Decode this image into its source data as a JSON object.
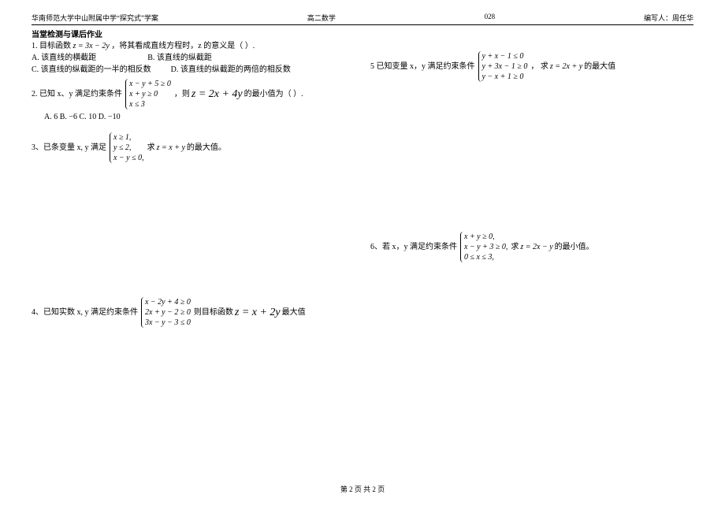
{
  "header": {
    "left": "华南师范大学中山附属中学“探究式”学案",
    "center_left": "高二数学",
    "center_right": "028",
    "right": "编写人：周任华"
  },
  "section_title": "当堂检测与课后作业",
  "q1": {
    "stem_a": "1.  目标函数",
    "formula": "z = 3x − 2y",
    "stem_b": "，将其看成直线方程时，z 的意义是（     ）.",
    "optA": "A. 该直线的横截距",
    "optB": "B. 该直线的纵截距",
    "optC": "C. 该直线的纵截距的一半的相反数",
    "optD": "D. 该直线的纵截距的两倍的相反数"
  },
  "q2": {
    "stem_a": "2. 已知 x、y 满足约束条件",
    "c1": "x − y + 5 ≥ 0",
    "c2": "x + y ≥ 0",
    "c3": "x ≤ 3",
    "mid": "，则",
    "formula": "z = 2x + 4y",
    "stem_b": "的最小值为（     ）.",
    "options": "  A.  6       B.  −6       C.  10       D.  −10"
  },
  "q3": {
    "stem_a": "3、已条变量 x, y 满足",
    "c1": "x ≥ 1,",
    "c2": "y ≤ 2,",
    "c3": "x − y ≤ 0,",
    "mid": "  求",
    "formula": "z = x + y",
    "stem_b": "的最大值。"
  },
  "q4": {
    "stem_a": "4、已知实数 x, y 满足约束条件",
    "c1": "x − 2y + 4 ≥ 0",
    "c2": "2x + y − 2 ≥ 0",
    "c3": "3x − y − 3 ≤ 0",
    "mid": "则目标函数",
    "formula": "z = x + 2y",
    "stem_b": "最大值"
  },
  "q5": {
    "stem_a": "5 已知变量 x，y 满足约束条件",
    "c1": "y + x − 1 ≤ 0",
    "c2": "y + 3x − 1 ≥ 0",
    "c3": "y − x + 1 ≥ 0",
    "mid": "，  求",
    "formula": "z = 2x + y",
    "stem_b": "的最大值"
  },
  "q6": {
    "stem_a": "6、若 x，y 满足约束条件",
    "c1": "x + y ≥ 0,",
    "c2": "x − y + 3 ≥ 0,",
    "c3": "0 ≤ x ≤ 3,",
    "mid": " 求",
    "formula": "z = 2x − y",
    "stem_b": "的最小值。"
  },
  "footer": "第 2 页 共 2 页"
}
